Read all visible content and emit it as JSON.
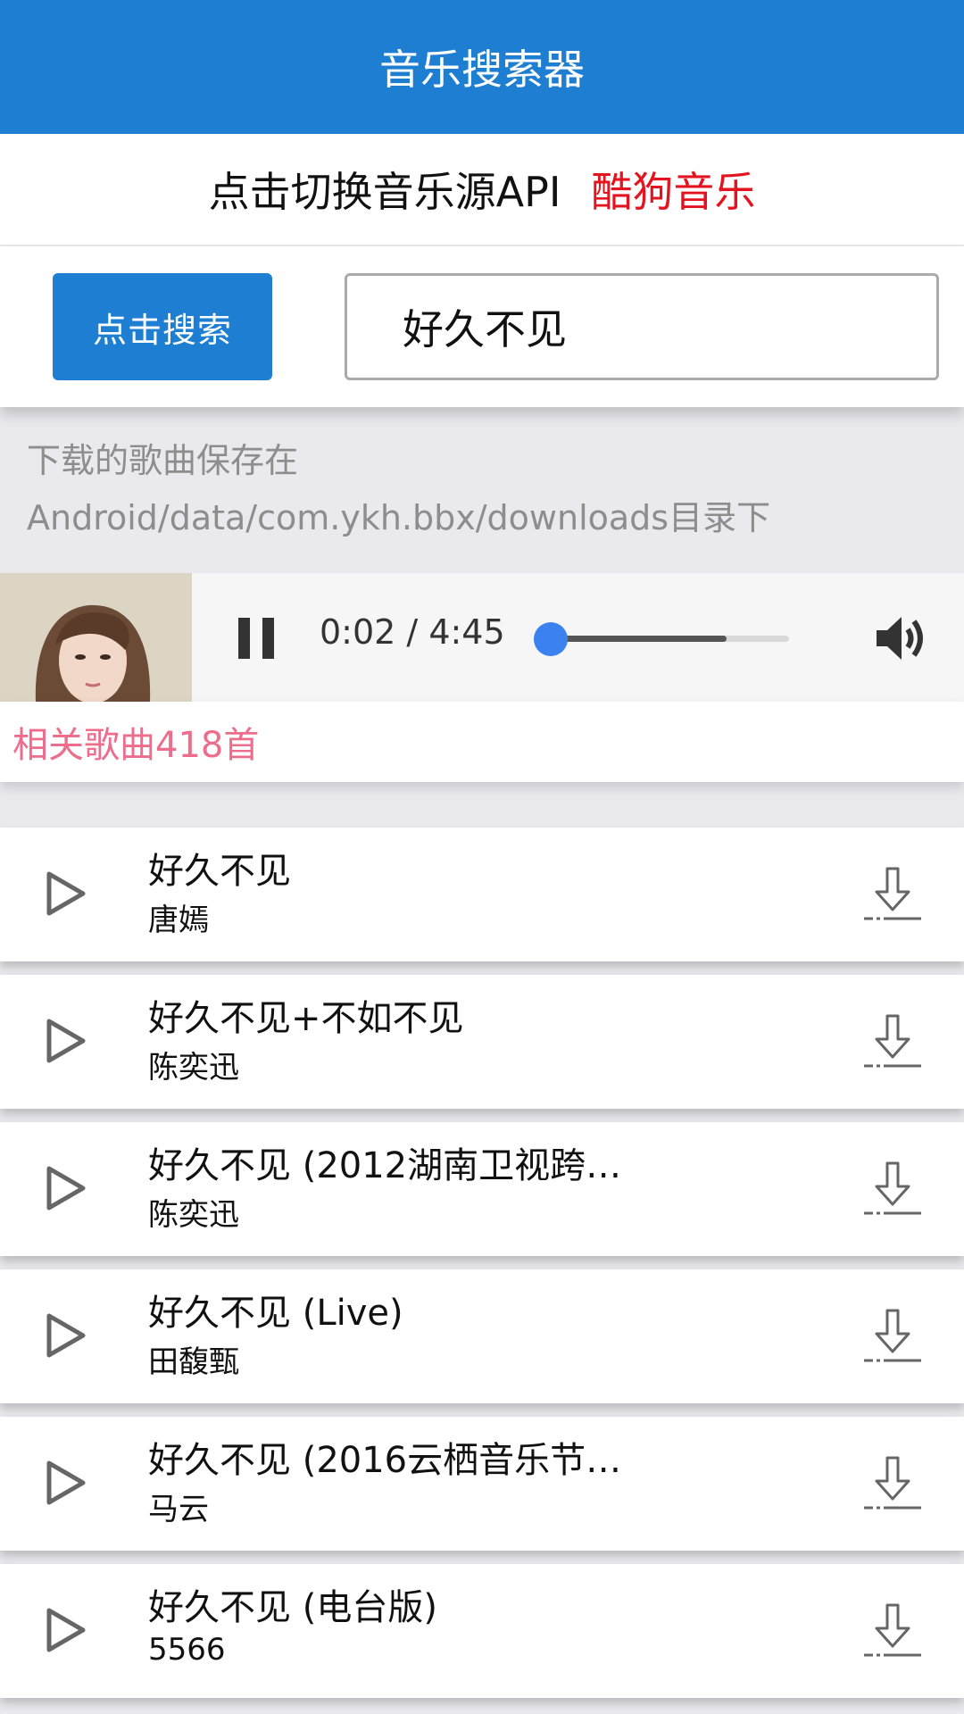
{
  "app_bar": {
    "title": "音乐搜索器"
  },
  "source": {
    "label": "点击切换音乐源API",
    "current": "酷狗音乐"
  },
  "search": {
    "button_label": "点击搜索",
    "query": "好久不见"
  },
  "note": {
    "line1": "下载的歌曲保存在",
    "line2": "Android/data/com.ykh.bbx/downloads目录下"
  },
  "player": {
    "current_time": "0:02",
    "separator": " / ",
    "duration": "4:45",
    "progress": 0.007,
    "buffered": 0.74,
    "play_state": "pause-icon",
    "volume_icon": "volume-icon"
  },
  "results": {
    "count_text": "相关歌曲418首"
  },
  "songs": [
    {
      "title": "好久不见",
      "artist": "唐嫣"
    },
    {
      "title": "好久不见+不如不见",
      "artist": "陈奕迅"
    },
    {
      "title": "好久不见 (2012湖南卫视跨…",
      "artist": "陈奕迅"
    },
    {
      "title": "好久不见 (Live)",
      "artist": "田馥甄"
    },
    {
      "title": "好久不见 (2016云栖音乐节…",
      "artist": "马云"
    },
    {
      "title": "好久不见 (电台版)",
      "artist": "5566"
    }
  ],
  "colors": {
    "primary": "#1e7fd2",
    "source_highlight": "#e3141f",
    "count_text": "#ec6d8c",
    "progress_knob": "#3b82f0"
  }
}
